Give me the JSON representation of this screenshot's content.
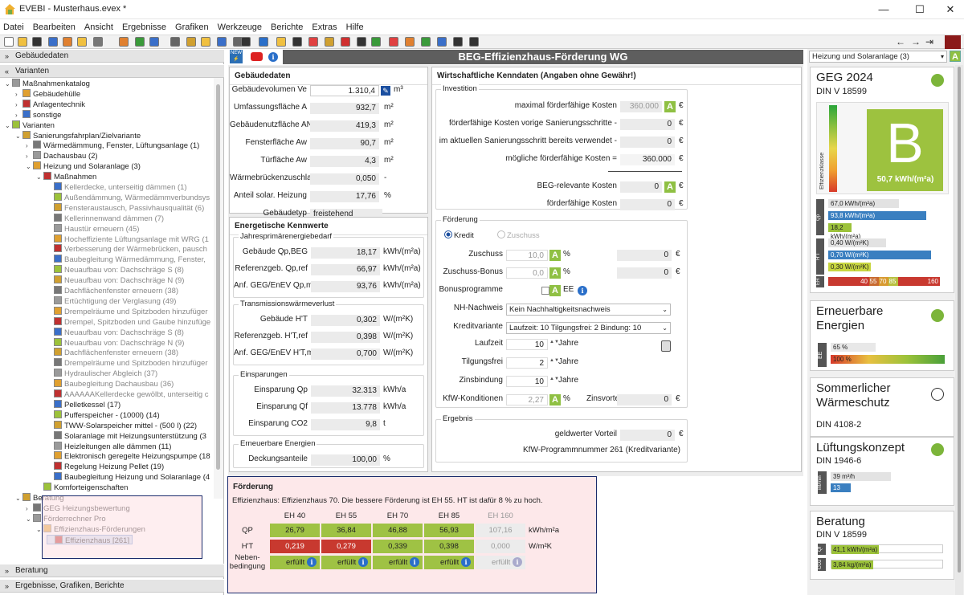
{
  "window": {
    "title": "EVEBI - Musterhaus.evex *"
  },
  "menu": [
    "Datei",
    "Bearbeiten",
    "Ansicht",
    "Ergebnisse",
    "Grafiken",
    "Werkzeuge",
    "Berichte",
    "Extras",
    "Hilfe"
  ],
  "left": {
    "sections": [
      "Gebäudedaten",
      "Varianten",
      "Beratung",
      "Ergebnisse, Grafiken, Berichte"
    ],
    "tree": [
      {
        "d": 0,
        "t": "Maßnahmenkatalog",
        "e": "v"
      },
      {
        "d": 1,
        "t": "Gebäudehülle",
        "e": ">"
      },
      {
        "d": 1,
        "t": "Anlagentechnik",
        "e": ">"
      },
      {
        "d": 1,
        "t": "sonstige",
        "e": ">"
      },
      {
        "d": 0,
        "t": "Varianten",
        "e": "v"
      },
      {
        "d": 1,
        "t": "Sanierungsfahrplan/Zielvariante",
        "e": "v"
      },
      {
        "d": 2,
        "t": "Wärmedämmung, Fenster, Lüftungsanlage (1)",
        "e": ">"
      },
      {
        "d": 2,
        "t": "Dachausbau (2)",
        "e": ">"
      },
      {
        "d": 2,
        "t": "Heizung und Solaranlage (3)",
        "e": "v"
      },
      {
        "d": 3,
        "t": "Maßnahmen",
        "e": "v"
      },
      {
        "d": 4,
        "t": "Kellerdecke, unterseitig dämmen (1)",
        "g": 1
      },
      {
        "d": 4,
        "t": "Außendämmung, Wärmedämmverbundsys",
        "g": 1
      },
      {
        "d": 4,
        "t": "Fensteraustausch, Passivhausqualität (6)",
        "g": 1
      },
      {
        "d": 4,
        "t": "Kellerinnenwand dämmen (7)",
        "g": 1
      },
      {
        "d": 4,
        "t": "Haustür erneuern (45)",
        "g": 1
      },
      {
        "d": 4,
        "t": "Hocheffiziente Lüftungsanlage mit WRG (1",
        "g": 1
      },
      {
        "d": 4,
        "t": "Verbesserung der Wärmebrücken, pausch",
        "g": 1
      },
      {
        "d": 4,
        "t": "Baubegleitung Wärmedämmung, Fenster,",
        "g": 1
      },
      {
        "d": 4,
        "t": "Neuaufbau von: Dachschräge S (8)",
        "g": 1
      },
      {
        "d": 4,
        "t": "Neuaufbau von: Dachschräge N (9)",
        "g": 1
      },
      {
        "d": 4,
        "t": "Dachflächenfenster erneuern (38)",
        "g": 1
      },
      {
        "d": 4,
        "t": "Ertüchtigung der Verglasung (49)",
        "g": 1
      },
      {
        "d": 4,
        "t": "Drempelräume und Spitzboden hinzufüger",
        "g": 1
      },
      {
        "d": 4,
        "t": "Drempel, Spitzboden und Gaube hinzufüge",
        "g": 1
      },
      {
        "d": 4,
        "t": "Neuaufbau von: Dachschräge S (8)",
        "g": 1
      },
      {
        "d": 4,
        "t": "Neuaufbau von: Dachschräge N (9)",
        "g": 1
      },
      {
        "d": 4,
        "t": "Dachflächenfenster erneuern (38)",
        "g": 1
      },
      {
        "d": 4,
        "t": "Drempelräume und Spitzboden hinzufüger",
        "g": 1
      },
      {
        "d": 4,
        "t": "Hydraulischer Abgleich (37)",
        "g": 1
      },
      {
        "d": 4,
        "t": "Baubegleitung Dachausbau (36)",
        "g": 1
      },
      {
        "d": 4,
        "t": "AAAAAAKellerdecke gewölbt, unterseitig c",
        "g": 1
      },
      {
        "d": 4,
        "t": "Pelletkessel (17)"
      },
      {
        "d": 4,
        "t": "Pufferspeicher - (1000l) (14)"
      },
      {
        "d": 4,
        "t": "TWW-Solarspeicher mittel - (500 l) (22)"
      },
      {
        "d": 4,
        "t": "Solaranlage mit Heizungsunterstützung (3"
      },
      {
        "d": 4,
        "t": "Heizleitungen alle dämmen (11)"
      },
      {
        "d": 4,
        "t": "Elektronisch geregelte Heizungspumpe (18"
      },
      {
        "d": 4,
        "t": "Regelung Heizung Pellet (19)"
      },
      {
        "d": 4,
        "t": "Baubegleitung Heizung und Solaranlage (4"
      },
      {
        "d": 3,
        "t": "Komforteigenschaften"
      },
      {
        "d": 1,
        "t": "Beratung",
        "e": "v"
      },
      {
        "d": 2,
        "t": "GEG Heizungsbewertung",
        "e": ">"
      },
      {
        "d": 2,
        "t": "Förderrechner Pro",
        "e": "v"
      },
      {
        "d": 3,
        "t": "Effizienzhaus-Förderungen",
        "e": "v"
      },
      {
        "d": 4,
        "t": "Effizienzhaus [261]",
        "sel": 1
      }
    ]
  },
  "main": {
    "title": "BEG-Effizienzhaus-Förderung WG"
  },
  "geb": {
    "title": "Gebäudedaten",
    "rows": [
      {
        "l": "Gebäudevolumen Ve",
        "v": "1.310,4",
        "u": "m³"
      },
      {
        "l": "Umfassungsfläche A",
        "v": "932,7",
        "u": "m²"
      },
      {
        "l": "Gebäudenutzfläche AN",
        "v": "419,3",
        "u": "m²"
      },
      {
        "l": "Fensterfläche Aw",
        "v": "90,7",
        "u": "m²"
      },
      {
        "l": "Türfläche Aw",
        "v": "4,3",
        "u": "m²"
      },
      {
        "l": "Wärmebrückenzuschlag",
        "v": "0,050",
        "u": "-"
      },
      {
        "l": "Anteil solar. Heizung",
        "v": "17,76",
        "u": "%"
      },
      {
        "l": "Gebäudetyp",
        "v": "freistehend",
        "u": ""
      }
    ]
  },
  "kenn": {
    "title": "Energetische Kennwerte",
    "g1": {
      "t": "Jahresprimärenergiebedarf",
      "rows": [
        {
          "l": "Gebäude Qp,BEG",
          "v": "18,17",
          "u": "kWh/(m²a)"
        },
        {
          "l": "Referenzgeb. Qp,ref",
          "v": "66,97",
          "u": "kWh/(m²a)"
        },
        {
          "l": "Anf. GEG/EnEV Qp,max",
          "v": "93,76",
          "u": "kWh/(m²a)"
        }
      ]
    },
    "g2": {
      "t": "Transmissionswärmeverlust",
      "rows": [
        {
          "l": "Gebäude H'T",
          "v": "0,302",
          "u": "W/(m²K)"
        },
        {
          "l": "Referenzgeb. H'T,ref",
          "v": "0,398",
          "u": "W/(m²K)"
        },
        {
          "l": "Anf. GEG/EnEV H'T,max",
          "v": "0,700",
          "u": "W/(m²K)"
        }
      ]
    },
    "g3": {
      "t": "Einsparungen",
      "rows": [
        {
          "l": "Einsparung Qp",
          "v": "32.313",
          "u": "kWh/a"
        },
        {
          "l": "Einsparung Qf",
          "v": "13.778",
          "u": "kWh/a"
        },
        {
          "l": "Einsparung CO2",
          "v": "9,8",
          "u": "t"
        }
      ]
    },
    "g4": {
      "t": "Erneuerbare Energien",
      "rows": [
        {
          "l": "Deckungsanteile",
          "v": "100,00",
          "u": "%"
        }
      ]
    }
  },
  "wirt": {
    "title": "Wirtschaftliche Kenndaten (Angaben ohne Gewähr!)",
    "inv": {
      "t": "Investition",
      "rows": [
        {
          "l": "maximal förderfähige Kosten",
          "v": "360.000"
        },
        {
          "l": "förderfähige Kosten vorige Sanierungsschritte -",
          "v": "0"
        },
        {
          "l": "im aktuellen Sanierungsschritt bereits verwendet -",
          "v": "0"
        },
        {
          "l": "mögliche förderfähige Kosten =",
          "v": "360.000"
        },
        {
          "l": "BEG-relevante Kosten",
          "v": "0"
        },
        {
          "l": "förderfähige Kosten",
          "v": "0"
        }
      ],
      "cur": "€"
    },
    "foe": {
      "t": "Förderung",
      "kredit": "Kredit",
      "zuschuss": "Zuschuss",
      "zus": {
        "l": "Zuschuss",
        "v": "10,0",
        "u": "%",
        "e": "0"
      },
      "zusb": {
        "l": "Zuschuss-Bonus",
        "v": "0,0",
        "u": "%",
        "e": "0"
      },
      "bonus": {
        "l": "Bonusprogramme",
        "ee": "EE"
      },
      "nh": {
        "l": "NH-Nachweis",
        "v": "Kein Nachhaltigkeitsnachweis"
      },
      "kv": {
        "l": "Kreditvariante",
        "v": "Laufzeit: 10 Tilgungsfrei: 2 Bindung: 10"
      },
      "lz": {
        "l": "Laufzeit",
        "v": "10",
        "u": "Jahre"
      },
      "tf": {
        "l": "Tilgungsfrei",
        "v": "2",
        "u": "Jahre"
      },
      "zb": {
        "l": "Zinsbindung",
        "v": "10",
        "u": "Jahre"
      },
      "kfw": {
        "l": "KfW-Konditionen",
        "v": "2,27",
        "u": "%",
        "zl": "Zinsvorteil",
        "zv": "0"
      }
    },
    "erg": {
      "t": "Ergebnis",
      "gv": "geldwerter Vorteil",
      "gvv": "0",
      "prog": "KfW-Programmnummer 261 (Kreditvariante)"
    }
  },
  "foerderung": {
    "title": "Förderung",
    "note": "Effizienzhaus: Effizienzhaus 70.  Die bessere Förderung ist EH 55. HT ist dafür 8 % zu hoch.",
    "cols": [
      "EH 40",
      "EH 55",
      "EH 70",
      "EH 85",
      "EH 160"
    ],
    "rows": [
      {
        "l": "QP",
        "v": [
          "26,79",
          "36,84",
          "46,88",
          "56,93",
          "107,16"
        ],
        "u": "kWh/m²a"
      },
      {
        "l": "H'T",
        "v": [
          "0,219",
          "0,279",
          "0,339",
          "0,398",
          "0,000"
        ],
        "u": "W/m²K"
      },
      {
        "l": "Neben-\nbedingung",
        "v": [
          "erfüllt",
          "erfüllt",
          "erfüllt",
          "erfüllt",
          "erfüllt"
        ]
      }
    ]
  },
  "right": {
    "dropdown": "Heizung und Solaranlage (3)",
    "geg": {
      "t": "GEG 2024",
      "s": "DIN V 18599",
      "klasse": "B",
      "effl": "Effizienzklasse",
      "val": "50,7 kWh/(m²a)",
      "qp": [
        {
          "t": "67,0 kWh/(m²a)",
          "f": 0.55
        },
        {
          "t": "93,8 kWh/(m²a)",
          "f": 0.76
        },
        {
          "t": "18,2 kWh/(m²a)",
          "f": 0.18
        }
      ],
      "ht": [
        {
          "t": "0,40 W/(m²K)",
          "f": 0.45
        },
        {
          "t": "0,70 W/(m²K)",
          "f": 0.8
        },
        {
          "t": "0,30 W/(m²K)",
          "f": 0.33
        }
      ],
      "eh": [
        "40",
        "55",
        "70",
        "85",
        "160"
      ],
      "lq": "Qp",
      "lh": "H'T",
      "leh": "EH"
    },
    "ee": {
      "t": "Erneuerbare Energien",
      "a": "65 %",
      "b": "100 %",
      "l": "EE"
    },
    "sw": {
      "t": "Sommerlicher Wärmeschutz",
      "s": "DIN 4108-2"
    },
    "lk": {
      "t": "Lüftungskonzept",
      "s": "DIN 1946-6",
      "a": "39 m³/h",
      "b": "13 m³/h",
      "l": "inf/min"
    },
    "ber": {
      "t": "Beratung",
      "s": "DIN V 18599",
      "a": "41,1 kWh/(m²a)",
      "b": "3,84 kg/(m²a)",
      "la": "Qf",
      "lb": "CO2"
    }
  }
}
